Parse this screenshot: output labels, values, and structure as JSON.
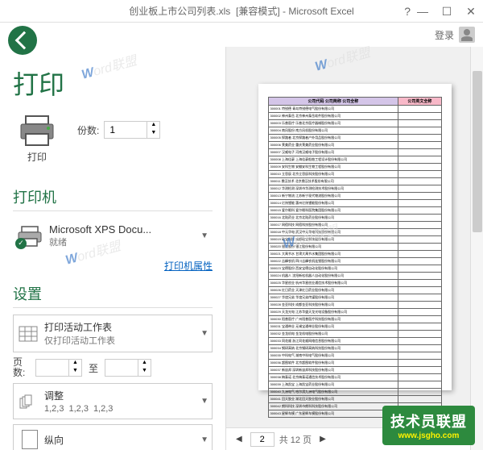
{
  "titlebar": {
    "filename": "创业板上市公司列表.xls",
    "mode": "[兼容模式]",
    "app": "Microsoft Excel"
  },
  "user": {
    "login": "登录"
  },
  "page": {
    "title": "打印"
  },
  "print": {
    "button_label": "打印",
    "copies_label": "份数:",
    "copies_value": "1"
  },
  "printer": {
    "section_title": "打印机",
    "name": "Microsoft XPS Docu...",
    "status": "就绪",
    "properties_link": "打印机属性"
  },
  "settings": {
    "section_title": "设置",
    "scope": {
      "title": "打印活动工作表",
      "sub": "仅打印活动工作表"
    },
    "pages": {
      "label": "页数:",
      "to_label": "至"
    },
    "collate": {
      "title": "调整",
      "items": [
        "1,2,3",
        "1,2,3",
        "1,2,3"
      ]
    },
    "orientation": {
      "title": "纵向"
    }
  },
  "preview": {
    "header1": "公司代码 公司简称 公司全称",
    "header2": "公司英文全称",
    "rows": [
      "300001 特锐德 青岛特锐德电气股份有限公司",
      "300002 神州泰岳 北京神州泰岳软件股份有限公司",
      "300003 乐普医疗 乐普北京医疗器械股份有限公司",
      "300004 南风股份 南方风机股份有限公司",
      "300005 探路者 北京探路者户外用品股份有限公司",
      "300006 莱美药业 重庆莱美药业股份有限公司",
      "300007 汉威电子 河南汉威电子股份有限公司",
      "300008 上海佳豪 上海佳豪船舶工程设计股份有限公司",
      "300009 安科生物 安徽安科生物工程股份有限公司",
      "300010 立思辰 北京立思辰科技股份有限公司",
      "300011 鼎汉技术 北京鼎汉技术股份有限公司",
      "300012 华测检测 深圳市华测检测技术股份有限公司",
      "300013 新宁物流 江苏新宁现代物流股份有限公司",
      "300014 亿纬锂能 惠州亿纬锂能股份有限公司",
      "300015 爱尔眼科 爱尔眼科医院集团股份有限公司",
      "300016 北陆药业 北京北陆药业股份有限公司",
      "300017 网宿科技 网宿科技股份有限公司",
      "300018 中元华电 武汉中元华电科技股份有限公司",
      "300019 硅宝科技 成都硅宝科技股份有限公司",
      "300020 银江股份 银江股份有限公司",
      "300021 大禹节水 甘肃大禹节水集团股份有限公司",
      "300022 吉峰农机 四川吉峰农机连锁股份有限公司",
      "300023 宝德股份 西安宝德自动化股份有限公司",
      "300024 机器人 沈阳新松机器人自动化股份有限公司",
      "300025 华星创业 杭州华星创业通信技术股份有限公司",
      "300026 红日药业 天津红日药业股份有限公司",
      "300027 华谊兄弟 华谊兄弟传媒股份有限公司",
      "300028 金亚科技 成都金亚科技股份有限公司",
      "300029 天龙光电 江苏华盛天龙光电设备股份有限公司",
      "300030 阳普医疗 广州阳普医疗科技股份有限公司",
      "300031 宝通带业 无锡宝通带业股份有限公司",
      "300032 金龙机电 金龙机电股份有限公司",
      "300033 同花顺 浙江同花顺网络信息股份有限公司",
      "300034 钢研高纳 北京钢研高纳科技股份有限公司",
      "300035 中科电气 湖南中科电气股份有限公司",
      "300036 超图软件 北京超图软件股份有限公司",
      "300037 新宙邦 深圳新宙邦科技股份有限公司",
      "300038 梅泰诺 北京梅泰诺通信技术股份有限公司",
      "300039 上海凯宝 上海凯宝药业股份有限公司",
      "300040 九洲电气 哈尔滨九洲电气股份有限公司",
      "300041 回天胶业 湖北回天胶业股份有限公司",
      "300042 朗科科技 深圳市朗科科技股份有限公司",
      "300043 星辉车模 广东星辉车模股份有限公司"
    ],
    "current_page": "2",
    "total_pages": "共 12 页"
  },
  "watermark": {
    "brand": "技术员联盟",
    "url": "www.jsgho.com"
  }
}
